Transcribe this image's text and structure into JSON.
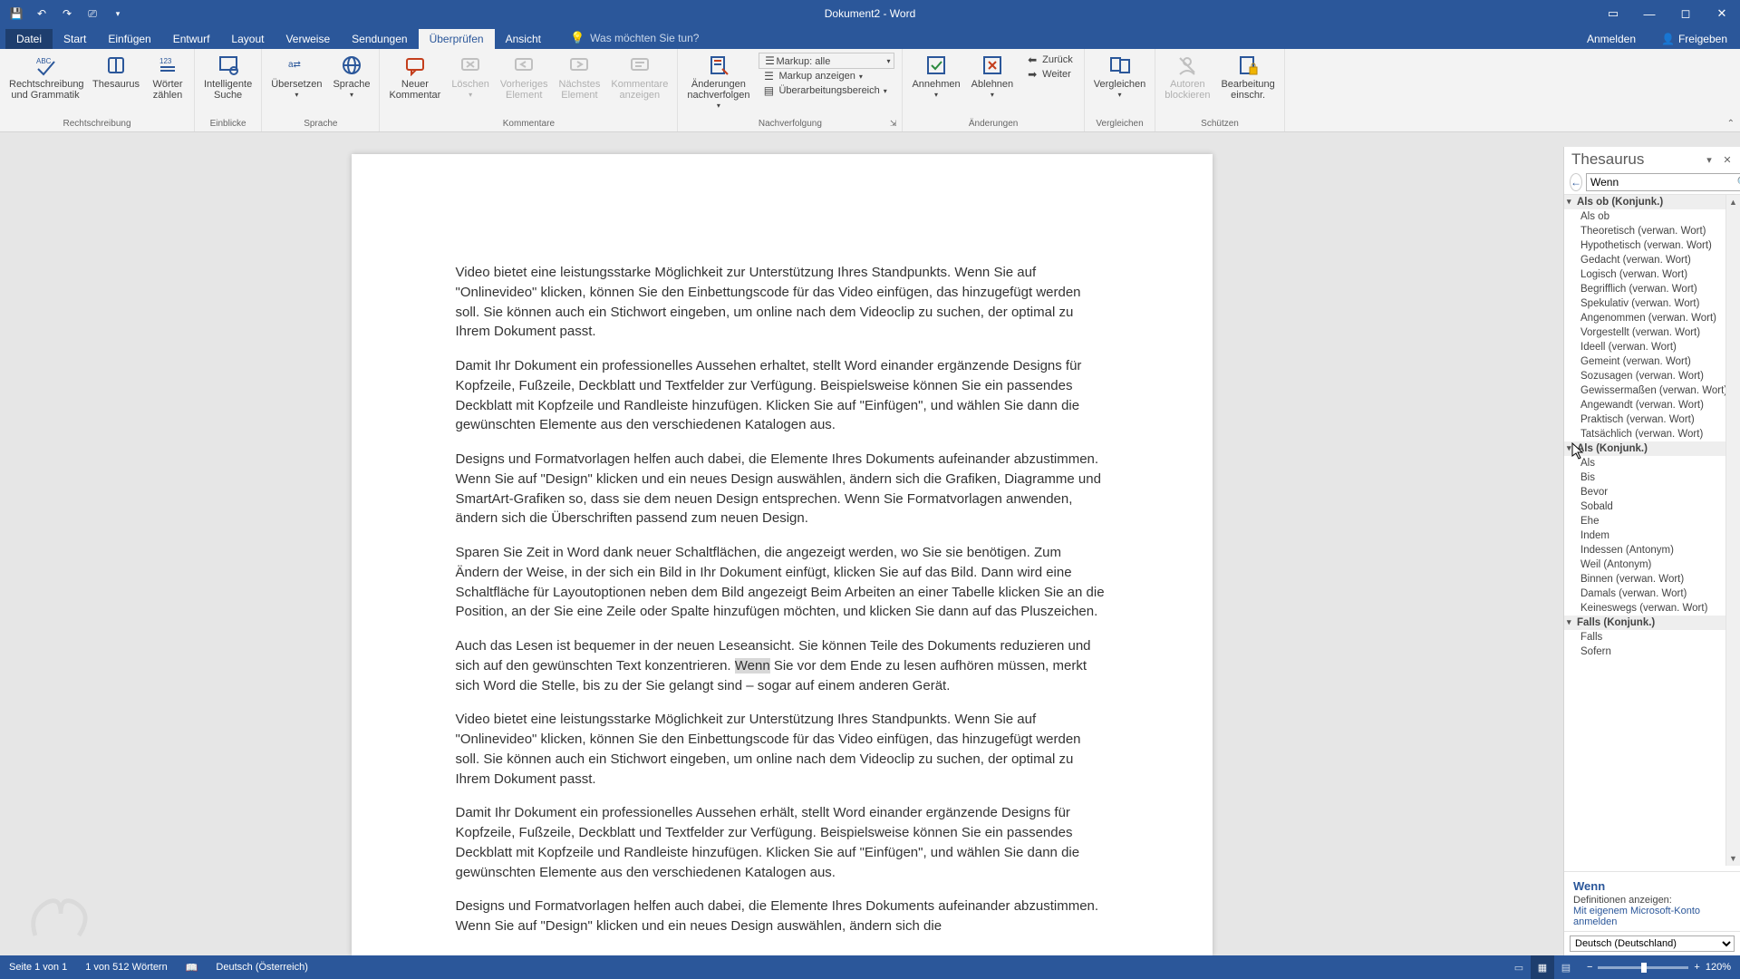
{
  "title": "Dokument2 - Word",
  "tabs": {
    "file": "Datei",
    "items": [
      "Start",
      "Einfügen",
      "Entwurf",
      "Layout",
      "Verweise",
      "Sendungen",
      "Überprüfen",
      "Ansicht"
    ],
    "active_index": 6,
    "tell_me": "Was möchten Sie tun?",
    "anmelden": "Anmelden",
    "freigeben": "Freigeben"
  },
  "ribbon": {
    "groups": [
      {
        "label": "Rechtschreibung",
        "buttons": [
          {
            "key": "spelling",
            "label": "Rechtschreibung\nund Grammatik"
          },
          {
            "key": "thesaurus",
            "label": "Thesaurus"
          },
          {
            "key": "wordcount",
            "label": "Wörter\nzählen"
          }
        ]
      },
      {
        "label": "Einblicke",
        "buttons": [
          {
            "key": "smart",
            "label": "Intelligente\nSuche"
          }
        ]
      },
      {
        "label": "Sprache",
        "buttons": [
          {
            "key": "translate",
            "label": "Übersetzen"
          },
          {
            "key": "language",
            "label": "Sprache"
          }
        ]
      },
      {
        "label": "Kommentare",
        "buttons": [
          {
            "key": "newcomment",
            "label": "Neuer\nKommentar"
          },
          {
            "key": "delete",
            "label": "Löschen",
            "disabled": true
          },
          {
            "key": "prev",
            "label": "Vorheriges\nElement",
            "disabled": true
          },
          {
            "key": "next",
            "label": "Nächstes\nElement",
            "disabled": true
          },
          {
            "key": "showcomments",
            "label": "Kommentare\nanzeigen",
            "disabled": true
          }
        ]
      },
      {
        "label": "Nachverfolgung",
        "big": [
          {
            "key": "track",
            "label": "Änderungen\nnachverfolgen"
          }
        ],
        "rows": [
          {
            "key": "markup",
            "label": "Markup: alle"
          },
          {
            "key": "showmarkup",
            "label": "Markup anzeigen"
          },
          {
            "key": "reviewpane",
            "label": "Überarbeitungsbereich"
          }
        ]
      },
      {
        "label": "Änderungen",
        "big": [
          {
            "key": "accept",
            "label": "Annehmen"
          },
          {
            "key": "reject",
            "label": "Ablehnen"
          }
        ],
        "rows": [
          {
            "key": "back",
            "label": "Zurück"
          },
          {
            "key": "forward",
            "label": "Weiter"
          }
        ]
      },
      {
        "label": "Vergleichen",
        "buttons": [
          {
            "key": "compare",
            "label": "Vergleichen"
          }
        ]
      },
      {
        "label": "Schützen",
        "buttons": [
          {
            "key": "block",
            "label": "Autoren\nblockieren",
            "disabled": true
          },
          {
            "key": "restrict",
            "label": "Bearbeitung\neinschr."
          }
        ]
      }
    ]
  },
  "document": {
    "paragraphs": [
      "Video bietet eine leistungsstarke Möglichkeit zur Unterstützung Ihres Standpunkts. Wenn Sie auf \"Onlinevideo\" klicken, können Sie den Einbettungscode für das Video einfügen, das hinzugefügt werden soll. Sie können auch ein Stichwort eingeben, um online nach dem Videoclip zu suchen, der optimal zu Ihrem Dokument passt.",
      "Damit Ihr Dokument ein professionelles Aussehen erhaltet, stellt Word einander ergänzende Designs für Kopfzeile, Fußzeile, Deckblatt und Textfelder zur Verfügung. Beispielsweise können Sie ein passendes Deckblatt mit Kopfzeile und Randleiste hinzufügen. Klicken Sie auf \"Einfügen\", und wählen Sie dann die gewünschten Elemente aus den verschiedenen Katalogen aus.",
      "Designs und Formatvorlagen helfen auch dabei, die Elemente Ihres Dokuments aufeinander abzustimmen. Wenn Sie auf \"Design\" klicken und ein neues Design auswählen, ändern sich die Grafiken, Diagramme und SmartArt-Grafiken so, dass sie dem neuen Design entsprechen. Wenn Sie Formatvorlagen anwenden, ändern sich die Überschriften passend zum neuen Design.",
      "Sparen Sie Zeit in Word dank neuer Schaltflächen, die angezeigt werden, wo Sie sie benötigen. Zum Ändern der Weise, in der sich ein Bild in Ihr Dokument einfügt, klicken Sie auf das Bild. Dann wird eine Schaltfläche für Layoutoptionen neben dem Bild angezeigt Beim Arbeiten an einer Tabelle klicken Sie an die Position, an der Sie eine Zeile oder Spalte hinzufügen möchten, und klicken Sie dann auf das Pluszeichen."
    ],
    "para5_pre": "Auch das Lesen ist bequemer in der neuen Leseansicht. Sie können Teile des Dokuments reduzieren und sich auf den gewünschten Text konzentrieren. ",
    "para5_hl": "Wenn",
    "para5_post": " Sie vor dem Ende zu lesen aufhören müssen, merkt sich Word die Stelle, bis zu der Sie gelangt sind – sogar auf einem anderen Gerät.",
    "paragraphs2": [
      "Video bietet eine leistungsstarke Möglichkeit zur Unterstützung Ihres Standpunkts. Wenn Sie auf \"Onlinevideo\" klicken, können Sie den Einbettungscode für das Video einfügen, das hinzugefügt werden soll. Sie können auch ein Stichwort eingeben, um online nach dem Videoclip zu suchen, der optimal zu Ihrem Dokument passt.",
      "Damit Ihr Dokument ein professionelles Aussehen erhält, stellt Word einander ergänzende Designs für Kopfzeile, Fußzeile, Deckblatt und Textfelder zur Verfügung. Beispielsweise können Sie ein passendes Deckblatt mit Kopfzeile und Randleiste hinzufügen. Klicken Sie auf \"Einfügen\", und wählen Sie dann die gewünschten Elemente aus den verschiedenen Katalogen aus.",
      "Designs und Formatvorlagen helfen auch dabei, die Elemente Ihres Dokuments aufeinander abzustimmen. Wenn Sie auf \"Design\" klicken und ein neues Design auswählen, ändern sich die"
    ]
  },
  "thesaurus": {
    "title": "Thesaurus",
    "search": "Wenn",
    "word": "Wenn",
    "defs_label": "Definitionen anzeigen:",
    "signin_link": "Mit eigenem Microsoft-Konto anmelden",
    "language": "Deutsch (Deutschland)",
    "groups": [
      {
        "head": "Als ob (Konjunk.)",
        "items": [
          "Als ob",
          "Theoretisch (verwan. Wort)",
          "Hypothetisch (verwan. Wort)",
          "Gedacht (verwan. Wort)",
          "Logisch (verwan. Wort)",
          "Begrifflich (verwan. Wort)",
          "Spekulativ (verwan. Wort)",
          "Angenommen (verwan. Wort)",
          "Vorgestellt (verwan. Wort)",
          "Ideell (verwan. Wort)",
          "Gemeint (verwan. Wort)",
          "Sozusagen (verwan. Wort)",
          "Gewissermaßen (verwan. Wort)",
          "Angewandt (verwan. Wort)",
          "Praktisch (verwan. Wort)",
          "Tatsächlich (verwan. Wort)"
        ]
      },
      {
        "head": "Als (Konjunk.)",
        "items": [
          "Als",
          "Bis",
          "Bevor",
          "Sobald",
          "Ehe",
          "Indem",
          "Indessen (Antonym)",
          "Weil (Antonym)",
          "Binnen (verwan. Wort)",
          "Damals (verwan. Wort)",
          "Keineswegs (verwan. Wort)"
        ]
      },
      {
        "head": "Falls (Konjunk.)",
        "items": [
          "Falls",
          "Sofern"
        ]
      }
    ]
  },
  "statusbar": {
    "page": "Seite 1 von 1",
    "words": "1 von 512 Wörtern",
    "lang": "Deutsch (Österreich)",
    "zoom": "120%"
  }
}
